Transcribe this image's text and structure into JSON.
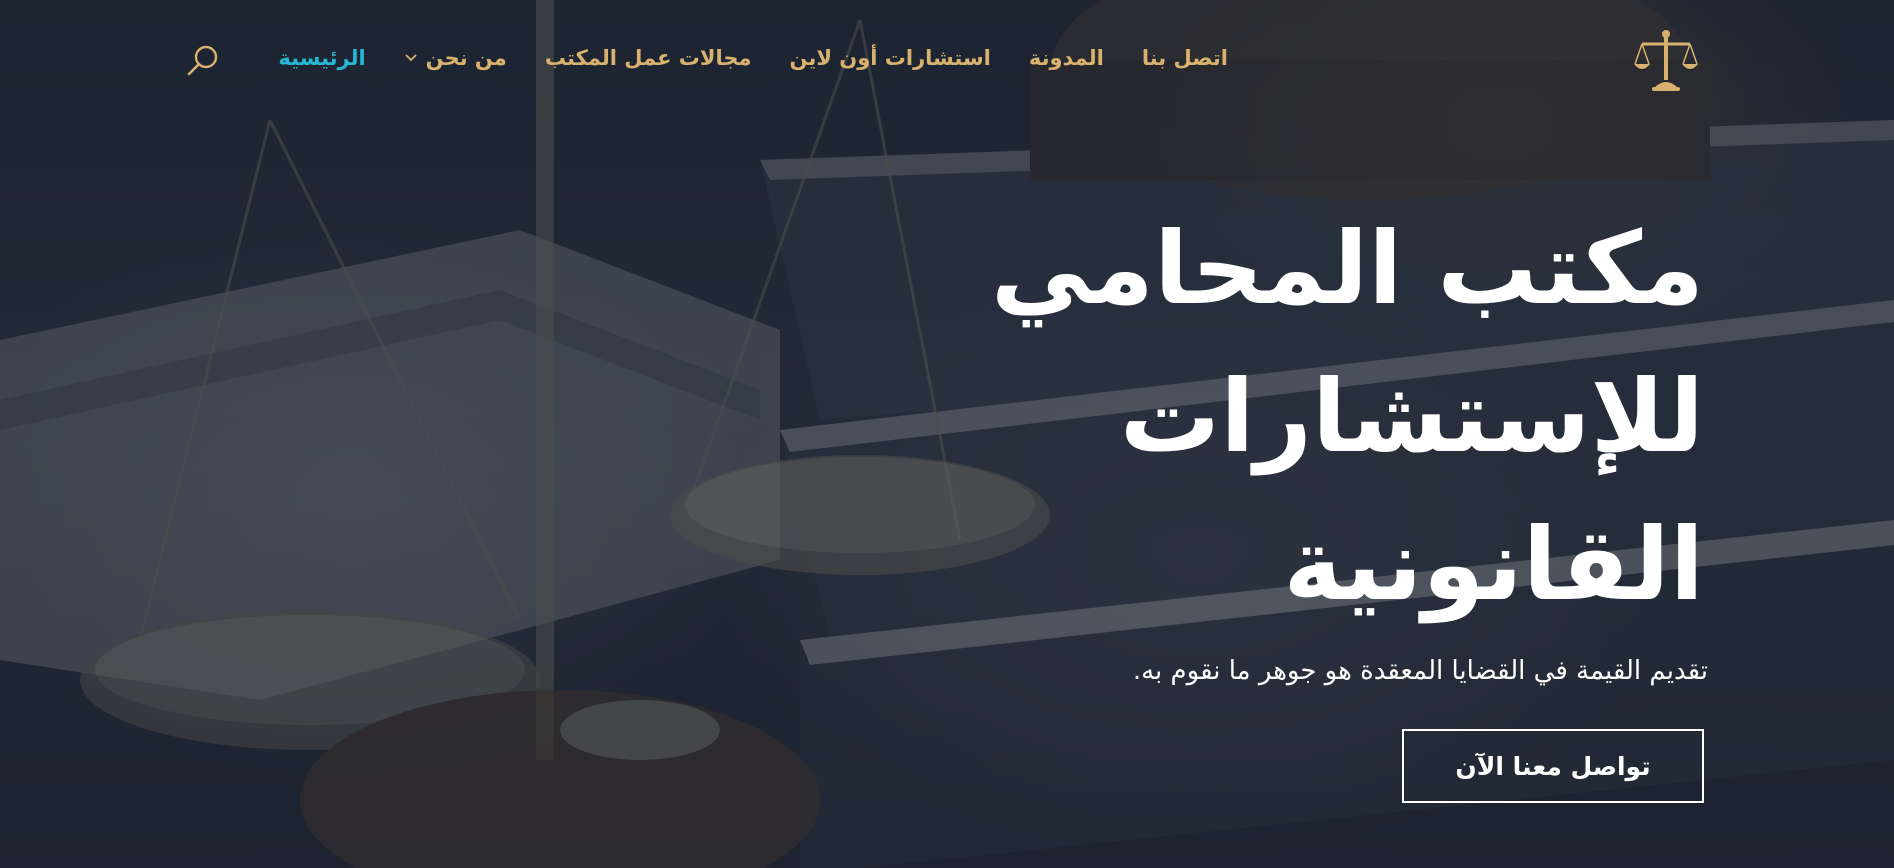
{
  "brand": {
    "logo_icon": "scales-of-justice-icon",
    "accent_gold": "#d8b26e",
    "accent_active": "#27b7d4"
  },
  "nav": {
    "items": [
      {
        "label": "الرئيسية",
        "active": true
      },
      {
        "label": "من نحن",
        "has_dropdown": true
      },
      {
        "label": "مجالات عمل المكتب"
      },
      {
        "label": "استشارات أون لاين"
      },
      {
        "label": "المدونة"
      },
      {
        "label": "اتصل بنا"
      }
    ],
    "search_icon": "search-icon"
  },
  "hero": {
    "title_lines": [
      "مكتب المحامي",
      "للإستشارات",
      "القانونية"
    ],
    "subtitle": "تقديم القيمة في القضايا المعقدة هو جوهر ما نقوم به.",
    "cta_label": "تواصل معنا الآن"
  }
}
